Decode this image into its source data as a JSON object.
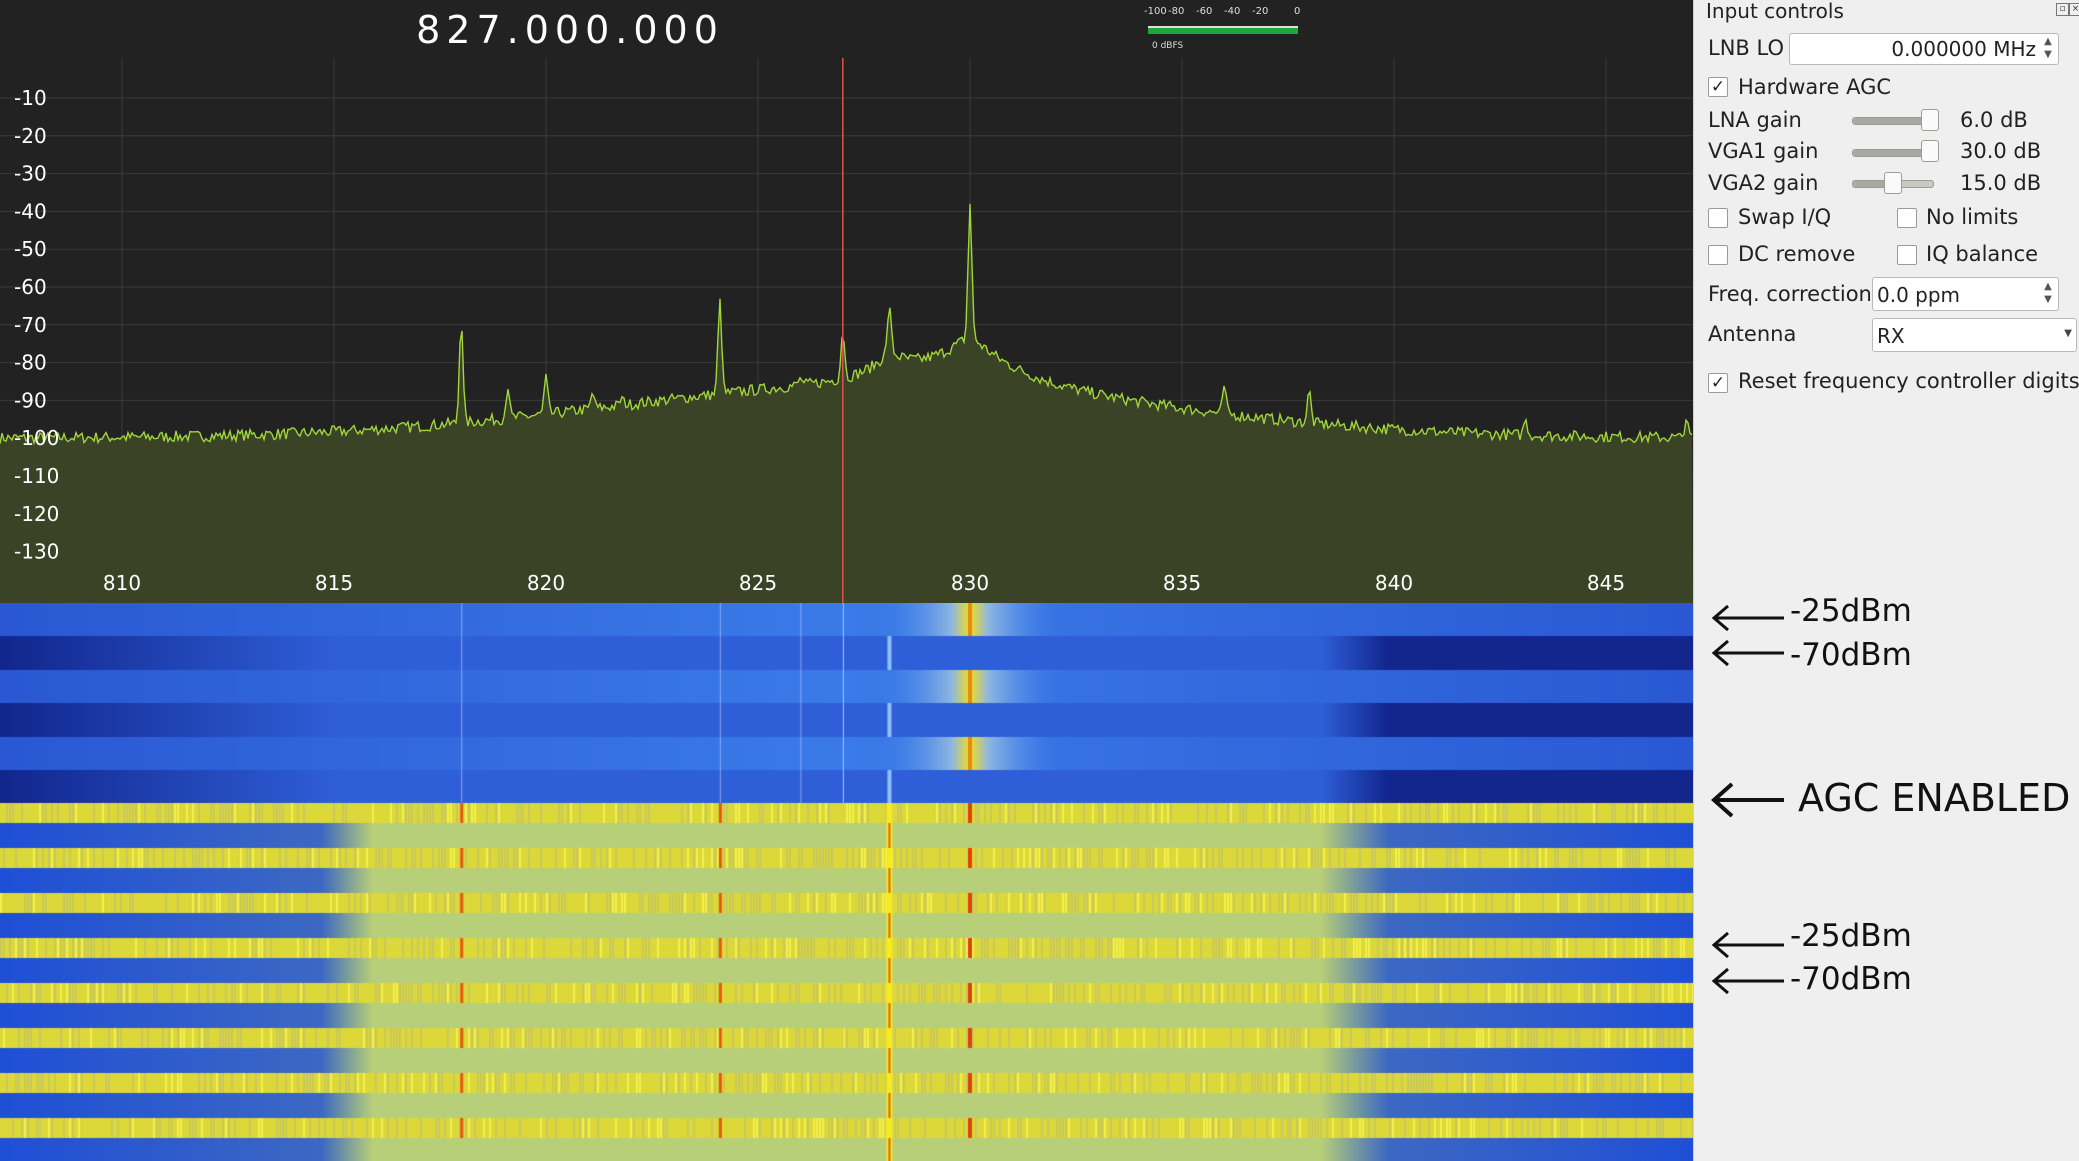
{
  "frequency_display": "827.000.000",
  "meter": {
    "ticks": [
      "-100",
      "-80",
      "-60",
      "-40",
      "-20",
      "0"
    ],
    "unit_label": "0 dBFS"
  },
  "spectrum": {
    "y_ticks": [
      "-10",
      "-20",
      "-30",
      "-40",
      "-50",
      "-60",
      "-70",
      "-80",
      "-90",
      "-100",
      "-110",
      "-120",
      "-130"
    ],
    "x_ticks": [
      "810",
      "815",
      "820",
      "825",
      "830",
      "835",
      "840",
      "845"
    ],
    "center_frequency_mhz": 827,
    "trace_color": "#9fd63a",
    "fill_color": "#3b4326",
    "marker_color": "#e05050"
  },
  "input_controls": {
    "title": "Input controls",
    "lnb_lo_label": "LNB LO",
    "lnb_lo_value": "0.000000 MHz",
    "hardware_agc_label": "Hardware AGC",
    "hardware_agc_checked": true,
    "gains": [
      {
        "label": "LNA gain",
        "value": "6.0 dB",
        "level": 1.0
      },
      {
        "label": "VGA1 gain",
        "value": "30.0 dB",
        "level": 1.0
      },
      {
        "label": "VGA2 gain",
        "value": "15.0 dB",
        "level": 0.5
      }
    ],
    "swap_iq_label": "Swap I/Q",
    "no_limits_label": "No limits",
    "dc_remove_label": "DC remove",
    "iq_balance_label": "IQ balance",
    "freq_correction_label": "Freq. correction",
    "freq_correction_value": "0.0 ppm",
    "antenna_label": "Antenna",
    "antenna_value": "RX",
    "reset_digits_label": "Reset frequency controller digits",
    "reset_digits_checked": true
  },
  "annotations": {
    "top_high": "-25dBm",
    "top_low": "-70dBm",
    "agc": "AGC ENABLED",
    "bottom_high": "-25dBm",
    "bottom_low": "-70dBm"
  },
  "colors": {
    "waterfall_blue": "#2f5fd8",
    "waterfall_dark_blue": "#12288f",
    "waterfall_yellow": "#e8e22a",
    "waterfall_green": "#b8cf7a"
  }
}
